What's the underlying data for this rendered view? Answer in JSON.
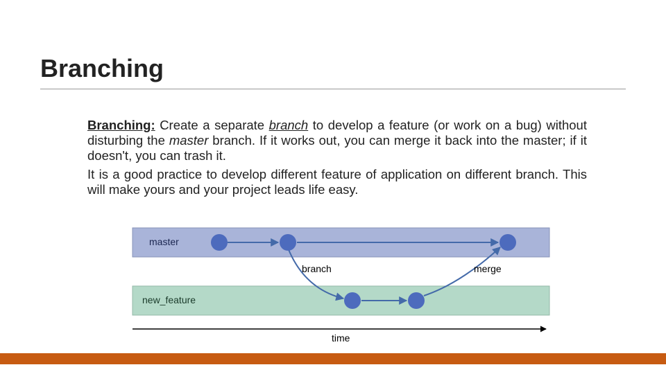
{
  "title": "Branching",
  "para1_lead": "Branching:",
  "para1_a": " Create a separate ",
  "para1_branch": "branch",
  "para1_b": " to develop a feature (or work on a bug) without disturbing the ",
  "para1_master": "master",
  "para1_c": " branch. If it works out, you can merge it back into the master; if it doesn't, you can trash it.",
  "para2": "It is a good practice to develop different feature of application on different branch. This will make yours and your project leads life easy.",
  "diagram": {
    "master_label": "master",
    "feature_label": "new_feature",
    "branch_label": "branch",
    "merge_label": "merge",
    "time_label": "time",
    "colors": {
      "master_band": "#a9b4d9",
      "feature_band": "#b4d9c8",
      "node": "#4d6bbd",
      "arrow": "#446aa9"
    }
  }
}
